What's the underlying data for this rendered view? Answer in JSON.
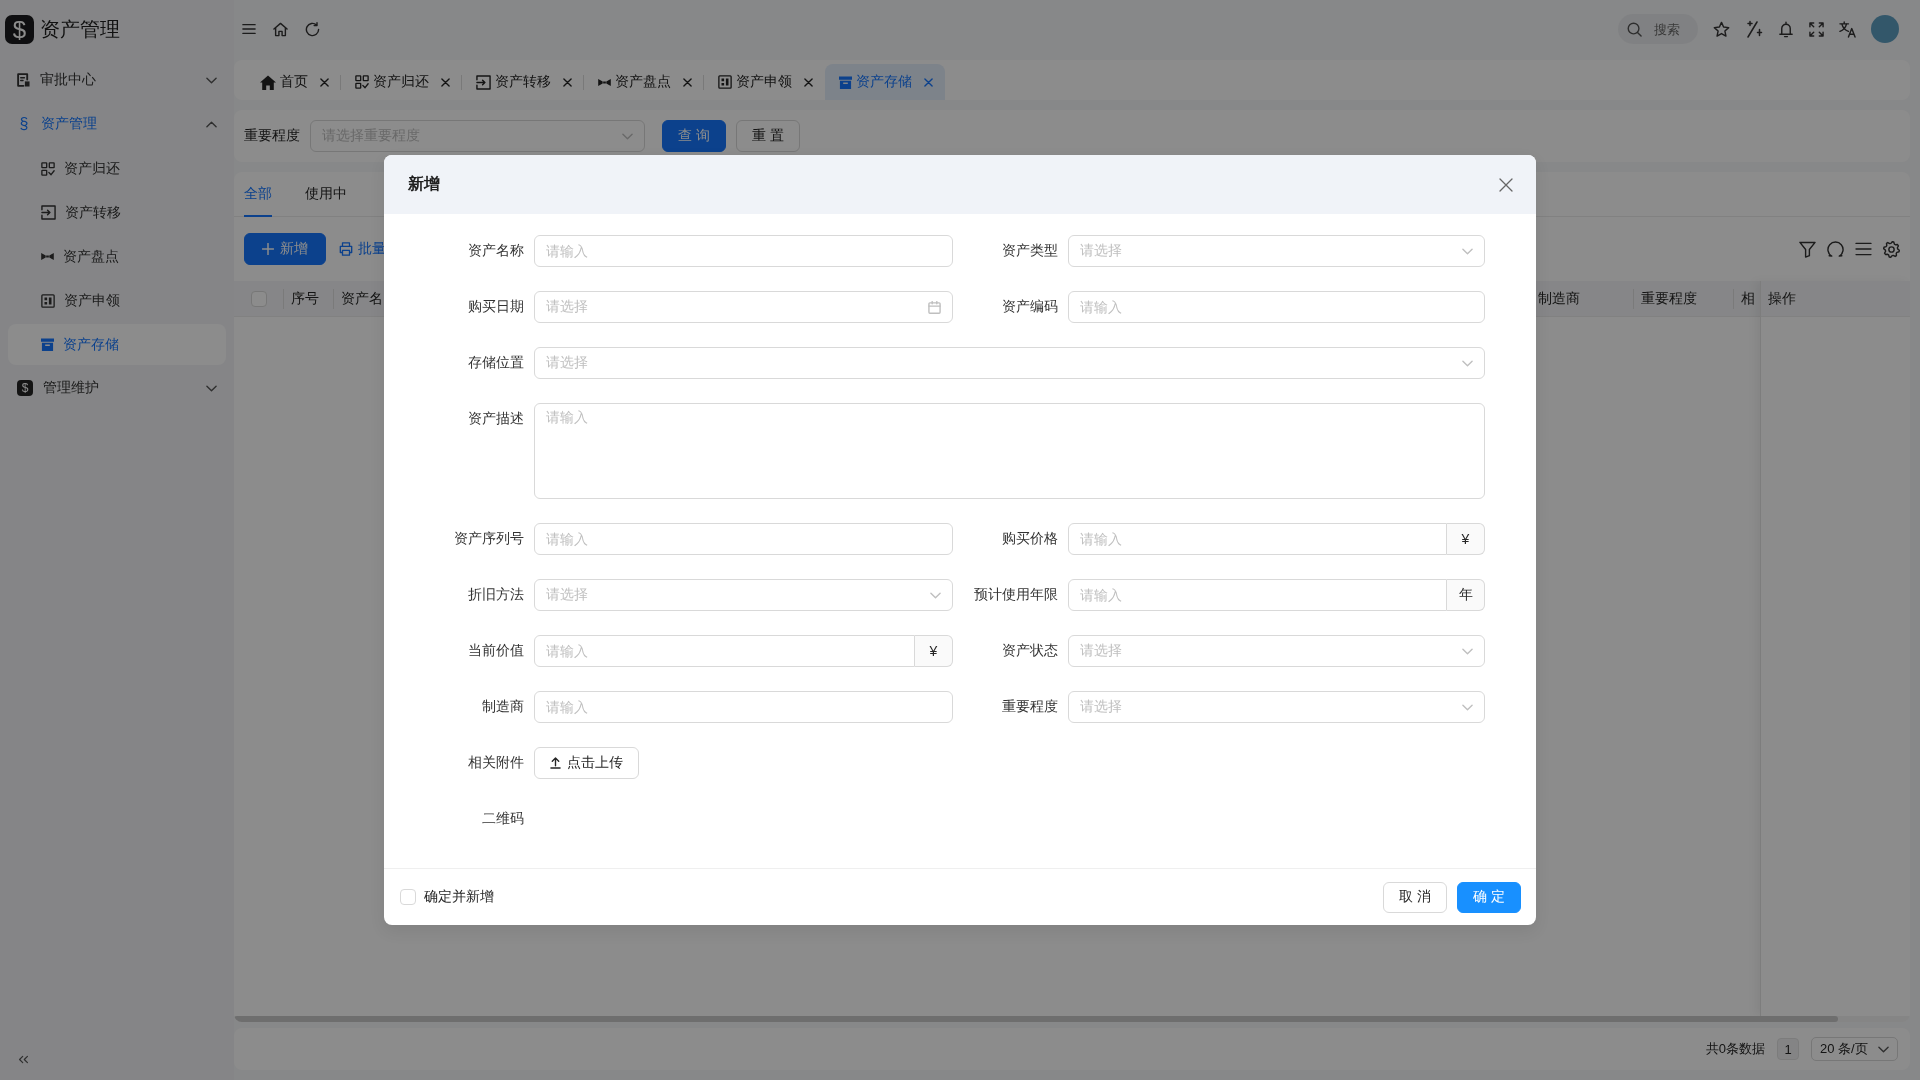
{
  "app": {
    "logo": "$",
    "title": "资产管理"
  },
  "sidebar": {
    "items": [
      {
        "kind": "icon",
        "label": "审批中心",
        "selected": false,
        "expanded": false
      },
      {
        "kind": "glyph",
        "glyph": "§",
        "label": "资产管理",
        "selected": true,
        "expanded": true,
        "children": [
          {
            "label": "资产归还",
            "selected": false
          },
          {
            "label": "资产转移",
            "selected": false
          },
          {
            "label": "资产盘点",
            "selected": false
          },
          {
            "label": "资产申领",
            "selected": false
          },
          {
            "label": "资产存储",
            "selected": true
          }
        ]
      },
      {
        "kind": "tile",
        "glyph": "$",
        "label": "管理维护",
        "selected": false,
        "expanded": false
      }
    ]
  },
  "header": {
    "search": {
      "placeholder": "搜索"
    }
  },
  "tabs": [
    {
      "label": "首页",
      "selected": false
    },
    {
      "label": "资产归还",
      "selected": false
    },
    {
      "label": "资产转移",
      "selected": false
    },
    {
      "label": "资产盘点",
      "selected": false
    },
    {
      "label": "资产申领",
      "selected": false
    },
    {
      "label": "资产存储",
      "selected": true
    }
  ],
  "filter": {
    "label": "重要程度",
    "placeholder": "请选择重要程度",
    "buttons": [
      {
        "label": "查 询",
        "kind": "primary"
      },
      {
        "label": "重 置",
        "kind": "default"
      }
    ]
  },
  "table": {
    "tabs": [
      {
        "label": "全部",
        "selected": true
      },
      {
        "label": "使用中",
        "selected": false
      }
    ],
    "toolbar": {
      "add_button": "新增",
      "batch_link": "批量"
    },
    "select_all": {
      "checked": false
    },
    "columns": [
      "序号",
      "资产名",
      "制造商",
      "重要程度",
      "相"
    ],
    "fixed_column": "操作"
  },
  "pagination": {
    "total": "共0条数据",
    "pages": [
      {
        "label": "1",
        "selected": true
      }
    ],
    "page_size": "20 条/页"
  },
  "dialog": {
    "title": "新增",
    "rows": [
      {
        "fields": [
          {
            "label": "资产名称",
            "kind": "input",
            "placeholder": "请输入"
          },
          {
            "label": "资产类型",
            "kind": "select",
            "placeholder": "请选择"
          }
        ]
      },
      {
        "fields": [
          {
            "label": "购买日期",
            "kind": "date",
            "placeholder": "请选择"
          },
          {
            "label": "资产编码",
            "kind": "input",
            "placeholder": "请输入"
          }
        ]
      },
      {
        "fields": [
          {
            "label": "存储位置",
            "kind": "select",
            "placeholder": "请选择"
          }
        ]
      },
      {
        "fields": [
          {
            "label": "资产描述",
            "kind": "textarea",
            "placeholder": "请输入"
          }
        ]
      },
      {
        "fields": [
          {
            "label": "资产序列号",
            "kind": "input",
            "placeholder": "请输入"
          },
          {
            "label": "购买价格",
            "kind": "input",
            "placeholder": "请输入",
            "addon": "¥"
          }
        ]
      },
      {
        "fields": [
          {
            "label": "折旧方法",
            "kind": "select",
            "placeholder": "请选择"
          },
          {
            "label": "预计使用年限",
            "kind": "input",
            "placeholder": "请输入",
            "addon": "年"
          }
        ]
      },
      {
        "fields": [
          {
            "label": "当前价值",
            "kind": "input",
            "placeholder": "请输入",
            "addon": "¥"
          },
          {
            "label": "资产状态",
            "kind": "select",
            "placeholder": "请选择"
          }
        ]
      },
      {
        "fields": [
          {
            "label": "制造商",
            "kind": "input",
            "placeholder": "请输入"
          },
          {
            "label": "重要程度",
            "kind": "select",
            "placeholder": "请选择"
          }
        ]
      },
      {
        "fields": [
          {
            "label": "相关附件",
            "kind": "upload",
            "button": "点击上传"
          }
        ]
      },
      {
        "fields": [
          {
            "label": "二维码",
            "kind": "qrcode"
          }
        ]
      }
    ],
    "footer": {
      "checkbox": {
        "label": "确定并新增",
        "checked": false
      },
      "buttons": [
        {
          "label": "取 消",
          "kind": "default"
        },
        {
          "label": "确 定",
          "kind": "primary"
        }
      ]
    }
  }
}
